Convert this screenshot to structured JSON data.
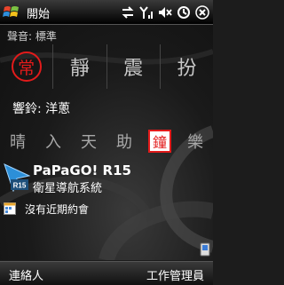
{
  "taskbar": {
    "start_label": "開始",
    "icons": [
      "sync-icon",
      "signal-icon",
      "volume-muted-icon",
      "connectivity-icon",
      "close-icon"
    ]
  },
  "today": {
    "sound_label": "聲音: 標準",
    "profiles": [
      {
        "glyph": "常",
        "active": true
      },
      {
        "glyph": "靜",
        "active": false
      },
      {
        "glyph": "震",
        "active": false
      },
      {
        "glyph": "扮",
        "active": false
      }
    ],
    "ringtone_label": "響鈴: 洋蔥",
    "ring_options": [
      {
        "glyph": "晴",
        "active": false
      },
      {
        "glyph": "入",
        "active": false
      },
      {
        "glyph": "天",
        "active": false
      },
      {
        "glyph": "助",
        "active": false
      },
      {
        "glyph": "鐘",
        "active": true
      },
      {
        "glyph": "樂",
        "active": false
      }
    ],
    "app": {
      "name": "PaPaGO! R15",
      "description": "衛星導航系統",
      "icon_text": "R15"
    },
    "calendar_text": "沒有近期約會",
    "accent_color": "#e21b1b"
  },
  "softkeys": {
    "left": "連絡人",
    "right": "工作管理員"
  }
}
